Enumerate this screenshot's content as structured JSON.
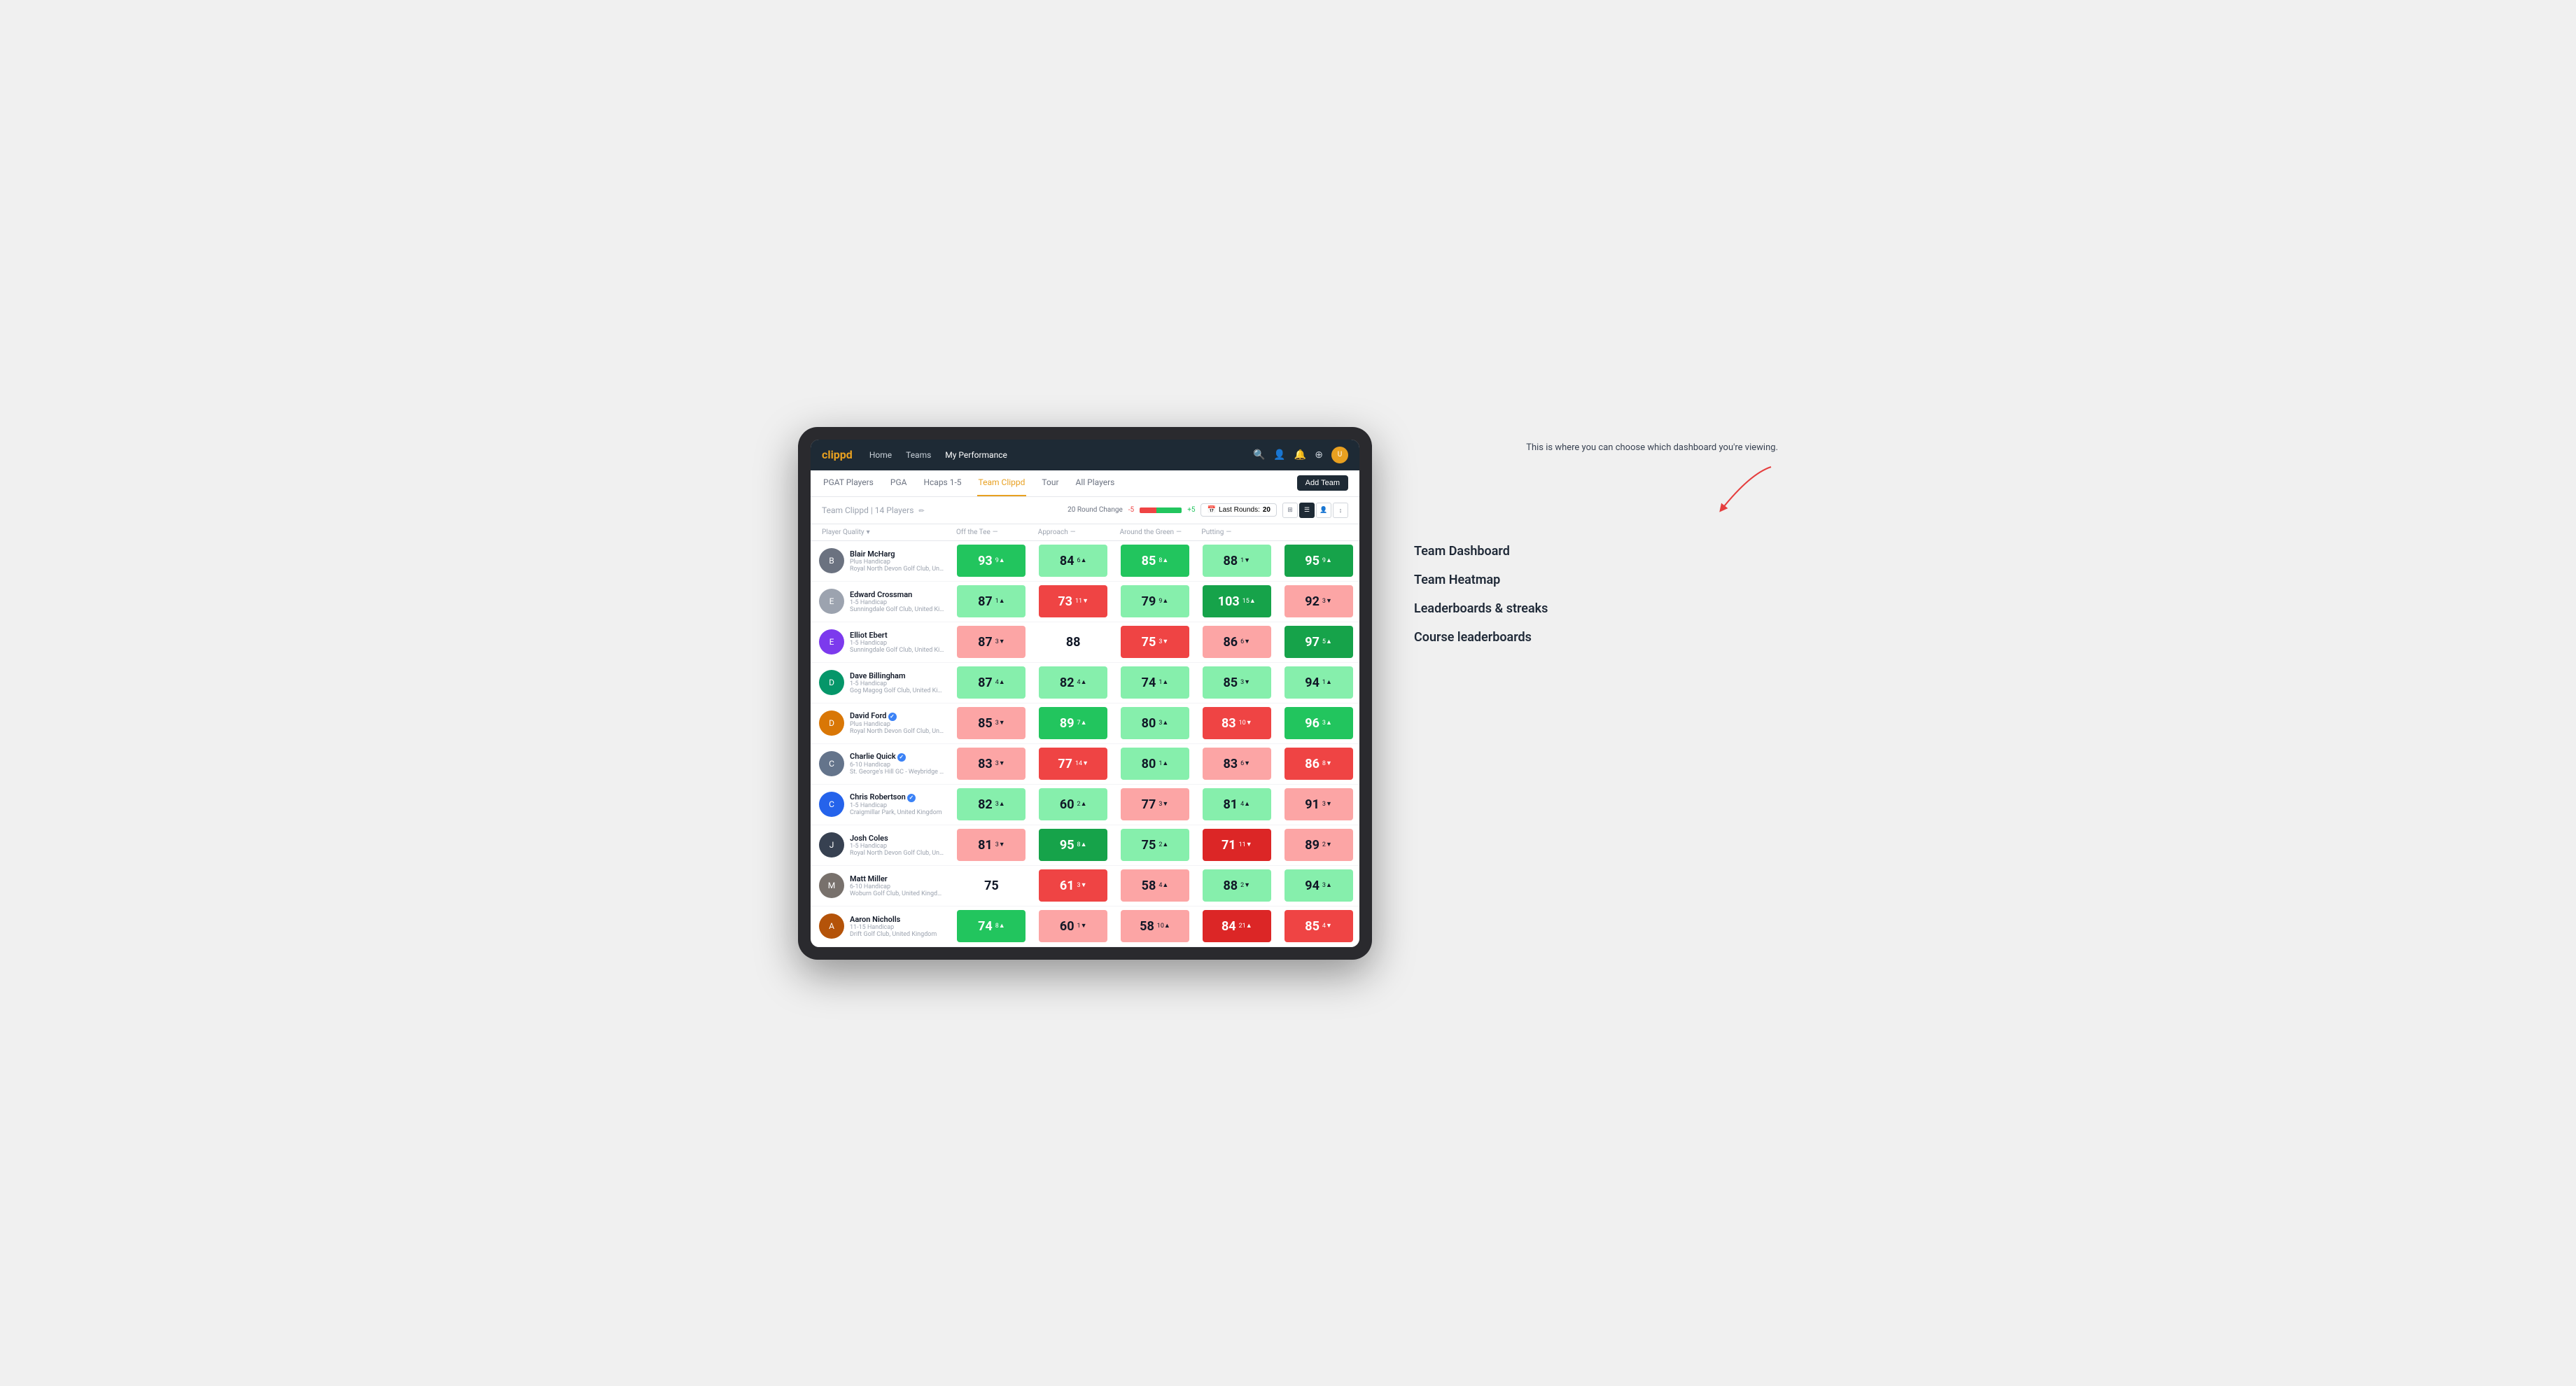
{
  "nav": {
    "logo": "clippd",
    "links": [
      {
        "label": "Home",
        "active": false
      },
      {
        "label": "Teams",
        "active": false
      },
      {
        "label": "My Performance",
        "active": true
      }
    ],
    "icons": [
      "🔍",
      "👤",
      "🔔",
      "⊕"
    ]
  },
  "subnav": {
    "links": [
      {
        "label": "PGAT Players",
        "active": false
      },
      {
        "label": "PGA",
        "active": false
      },
      {
        "label": "Hcaps 1-5",
        "active": false
      },
      {
        "label": "Team Clippd",
        "active": true
      },
      {
        "label": "Tour",
        "active": false
      },
      {
        "label": "All Players",
        "active": false
      }
    ],
    "add_button": "Add Team"
  },
  "team_header": {
    "title": "Team Clippd",
    "separator": "|",
    "count": "14 Players",
    "round_change_label": "20 Round Change",
    "score_neg": "-5",
    "score_pos": "+5",
    "last_rounds_label": "Last Rounds:",
    "last_rounds_value": "20"
  },
  "table": {
    "columns": [
      {
        "label": "Player Quality",
        "sortable": true
      },
      {
        "label": "Off the Tee",
        "sortable": true
      },
      {
        "label": "Approach",
        "sortable": true
      },
      {
        "label": "Around the Green",
        "sortable": true
      },
      {
        "label": "Putting",
        "sortable": true
      }
    ],
    "rows": [
      {
        "name": "Blair McHarg",
        "handicap": "Plus Handicap",
        "club": "Royal North Devon Golf Club, United Kingdom",
        "avatar_letter": "B",
        "avatar_color": "#6b7280",
        "scores": [
          {
            "value": 93,
            "change": "9",
            "dir": "up",
            "color": "green"
          },
          {
            "value": 84,
            "change": "6",
            "dir": "up",
            "color": "light-green"
          },
          {
            "value": 85,
            "change": "8",
            "dir": "up",
            "color": "green"
          },
          {
            "value": 88,
            "change": "1",
            "dir": "down",
            "color": "light-green"
          },
          {
            "value": 95,
            "change": "9",
            "dir": "up",
            "color": "dark-green"
          }
        ]
      },
      {
        "name": "Edward Crossman",
        "handicap": "1-5 Handicap",
        "club": "Sunningdale Golf Club, United Kingdom",
        "avatar_letter": "E",
        "avatar_color": "#9ca3af",
        "scores": [
          {
            "value": 87,
            "change": "1",
            "dir": "up",
            "color": "light-green"
          },
          {
            "value": 73,
            "change": "11",
            "dir": "down",
            "color": "red"
          },
          {
            "value": 79,
            "change": "9",
            "dir": "up",
            "color": "light-green"
          },
          {
            "value": 103,
            "change": "15",
            "dir": "up",
            "color": "dark-green"
          },
          {
            "value": 92,
            "change": "3",
            "dir": "down",
            "color": "light-red"
          }
        ]
      },
      {
        "name": "Elliot Ebert",
        "handicap": "1-5 Handicap",
        "club": "Sunningdale Golf Club, United Kingdom",
        "avatar_letter": "E",
        "avatar_color": "#7c3aed",
        "scores": [
          {
            "value": 87,
            "change": "3",
            "dir": "down",
            "color": "light-red"
          },
          {
            "value": 88,
            "change": "",
            "dir": "",
            "color": "white"
          },
          {
            "value": 75,
            "change": "3",
            "dir": "down",
            "color": "red"
          },
          {
            "value": 86,
            "change": "6",
            "dir": "down",
            "color": "light-red"
          },
          {
            "value": 97,
            "change": "5",
            "dir": "up",
            "color": "dark-green"
          }
        ]
      },
      {
        "name": "Dave Billingham",
        "handicap": "1-5 Handicap",
        "club": "Gog Magog Golf Club, United Kingdom",
        "avatar_letter": "D",
        "avatar_color": "#059669",
        "scores": [
          {
            "value": 87,
            "change": "4",
            "dir": "up",
            "color": "light-green"
          },
          {
            "value": 82,
            "change": "4",
            "dir": "up",
            "color": "light-green"
          },
          {
            "value": 74,
            "change": "1",
            "dir": "up",
            "color": "light-green"
          },
          {
            "value": 85,
            "change": "3",
            "dir": "down",
            "color": "light-green"
          },
          {
            "value": 94,
            "change": "1",
            "dir": "up",
            "color": "light-green"
          }
        ]
      },
      {
        "name": "David Ford",
        "handicap": "Plus Handicap",
        "club": "Royal North Devon Golf Club, United Kingdom",
        "avatar_letter": "D",
        "avatar_color": "#d97706",
        "verified": true,
        "scores": [
          {
            "value": 85,
            "change": "3",
            "dir": "down",
            "color": "light-red"
          },
          {
            "value": 89,
            "change": "7",
            "dir": "up",
            "color": "green"
          },
          {
            "value": 80,
            "change": "3",
            "dir": "up",
            "color": "light-green"
          },
          {
            "value": 83,
            "change": "10",
            "dir": "down",
            "color": "red"
          },
          {
            "value": 96,
            "change": "3",
            "dir": "up",
            "color": "green"
          }
        ]
      },
      {
        "name": "Charlie Quick",
        "handicap": "6-10 Handicap",
        "club": "St. George's Hill GC - Weybridge - Surrey, Uni...",
        "avatar_letter": "C",
        "avatar_color": "#64748b",
        "verified": true,
        "scores": [
          {
            "value": 83,
            "change": "3",
            "dir": "down",
            "color": "light-red"
          },
          {
            "value": 77,
            "change": "14",
            "dir": "down",
            "color": "red"
          },
          {
            "value": 80,
            "change": "1",
            "dir": "up",
            "color": "light-green"
          },
          {
            "value": 83,
            "change": "6",
            "dir": "down",
            "color": "light-red"
          },
          {
            "value": 86,
            "change": "8",
            "dir": "down",
            "color": "red"
          }
        ]
      },
      {
        "name": "Chris Robertson",
        "handicap": "1-5 Handicap",
        "club": "Craigmillar Park, United Kingdom",
        "avatar_letter": "C",
        "avatar_color": "#2563eb",
        "verified": true,
        "scores": [
          {
            "value": 82,
            "change": "3",
            "dir": "up",
            "color": "light-green"
          },
          {
            "value": 60,
            "change": "2",
            "dir": "up",
            "color": "light-green"
          },
          {
            "value": 77,
            "change": "3",
            "dir": "down",
            "color": "light-red"
          },
          {
            "value": 81,
            "change": "4",
            "dir": "up",
            "color": "light-green"
          },
          {
            "value": 91,
            "change": "3",
            "dir": "down",
            "color": "light-red"
          }
        ]
      },
      {
        "name": "Josh Coles",
        "handicap": "1-5 Handicap",
        "club": "Royal North Devon Golf Club, United Kingdom",
        "avatar_letter": "J",
        "avatar_color": "#374151",
        "scores": [
          {
            "value": 81,
            "change": "3",
            "dir": "down",
            "color": "light-red"
          },
          {
            "value": 95,
            "change": "8",
            "dir": "up",
            "color": "dark-green"
          },
          {
            "value": 75,
            "change": "2",
            "dir": "up",
            "color": "light-green"
          },
          {
            "value": 71,
            "change": "11",
            "dir": "down",
            "color": "dark-red"
          },
          {
            "value": 89,
            "change": "2",
            "dir": "down",
            "color": "light-red"
          }
        ]
      },
      {
        "name": "Matt Miller",
        "handicap": "6-10 Handicap",
        "club": "Woburn Golf Club, United Kingdom",
        "avatar_letter": "M",
        "avatar_color": "#78716c",
        "scores": [
          {
            "value": 75,
            "change": "",
            "dir": "",
            "color": "white"
          },
          {
            "value": 61,
            "change": "3",
            "dir": "down",
            "color": "red"
          },
          {
            "value": 58,
            "change": "4",
            "dir": "up",
            "color": "light-red"
          },
          {
            "value": 88,
            "change": "2",
            "dir": "down",
            "color": "light-green"
          },
          {
            "value": 94,
            "change": "3",
            "dir": "up",
            "color": "light-green"
          }
        ]
      },
      {
        "name": "Aaron Nicholls",
        "handicap": "11-15 Handicap",
        "club": "Drift Golf Club, United Kingdom",
        "avatar_letter": "A",
        "avatar_color": "#b45309",
        "scores": [
          {
            "value": 74,
            "change": "8",
            "dir": "up",
            "color": "green"
          },
          {
            "value": 60,
            "change": "1",
            "dir": "down",
            "color": "light-red"
          },
          {
            "value": 58,
            "change": "10",
            "dir": "up",
            "color": "light-red"
          },
          {
            "value": 84,
            "change": "21",
            "dir": "up",
            "color": "dark-red"
          },
          {
            "value": 85,
            "change": "4",
            "dir": "down",
            "color": "red"
          }
        ]
      }
    ]
  },
  "annotation": {
    "intro_text": "This is where you can choose which dashboard you're viewing.",
    "items": [
      {
        "label": "Team Dashboard"
      },
      {
        "label": "Team Heatmap"
      },
      {
        "label": "Leaderboards & streaks"
      },
      {
        "label": "Course leaderboards"
      }
    ]
  }
}
